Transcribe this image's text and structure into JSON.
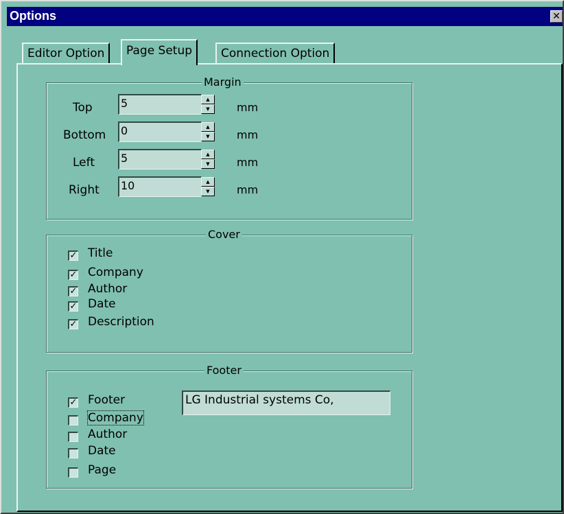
{
  "window": {
    "title": "Options",
    "close_glyph": "✕",
    "close_icon": "close-icon"
  },
  "tabs": [
    {
      "label": "Editor Option",
      "active": false
    },
    {
      "label": "Page Setup",
      "active": true
    },
    {
      "label": "Connection Option",
      "active": false
    }
  ],
  "margin": {
    "label": "Margin",
    "unit": "mm",
    "spinner_icons": {
      "up": "arrow-up-icon",
      "down": "arrow-down-icon"
    },
    "fields": [
      {
        "label": "Top",
        "value": "5"
      },
      {
        "label": "Bottom",
        "value": "0"
      },
      {
        "label": "Left",
        "value": "5"
      },
      {
        "label": "Right",
        "value": "10"
      }
    ]
  },
  "cover": {
    "label": "Cover",
    "items": [
      {
        "label": "Title",
        "checked": true
      },
      {
        "label": "Company",
        "checked": true
      },
      {
        "label": "Author",
        "checked": true
      },
      {
        "label": "Date",
        "checked": true
      },
      {
        "label": "Description",
        "checked": true
      }
    ]
  },
  "footer": {
    "label": "Footer",
    "text_value": "LG Industrial systems Co,",
    "items": [
      {
        "label": "Footer",
        "checked": true
      },
      {
        "label": "Company",
        "checked": false
      },
      {
        "label": "Author",
        "checked": false
      },
      {
        "label": "Date",
        "checked": false
      },
      {
        "label": "Page",
        "checked": false
      }
    ]
  },
  "colors": {
    "dialog_bg": "#80c0b0",
    "title_bar": "#000080",
    "field_bg": "#c0dcd4"
  }
}
